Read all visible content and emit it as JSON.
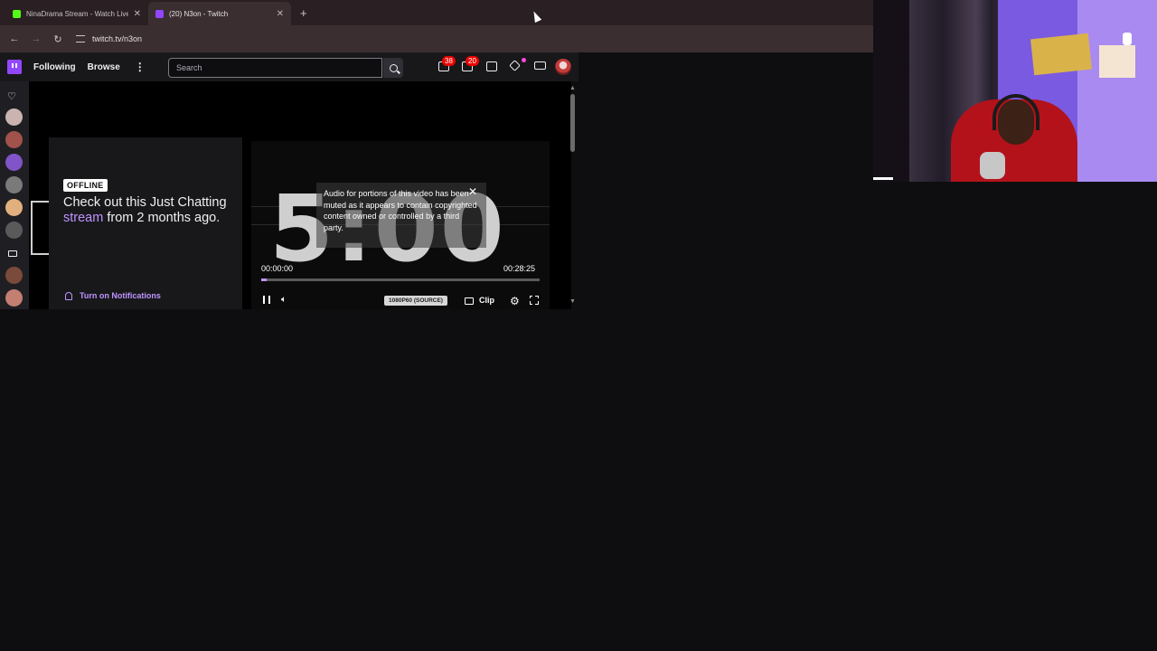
{
  "browser": {
    "tabs": [
      {
        "title": "NinaDrama Stream - Watch Live",
        "favicon_color": "#53fc18"
      },
      {
        "title": "(20) N3on - Twitch",
        "favicon_color": "#9147ff"
      }
    ],
    "url": "twitch.tv/n3on"
  },
  "twitch_nav": {
    "following": "Following",
    "browse": "Browse",
    "search_placeholder": "Search",
    "badge_1": "38",
    "badge_2": "20"
  },
  "offline": {
    "badge": "OFFLINE",
    "text_prefix": "Check out this Just Chatting ",
    "text_link": "stream",
    "text_suffix": " from 2 months ago.",
    "notifications": "Turn on Notifications"
  },
  "player": {
    "big_time": "5:00",
    "muted_notice": "Audio for portions of this video has been muted as it appears to contain copyrighted content owned or controlled by a third party.",
    "current_time": "00:00:00",
    "duration": "00:28:25",
    "progress_fraction": 0.02,
    "quality": "1080P60 (SOURCE)",
    "clip": "Clip"
  },
  "colors": {
    "twitch_purple": "#9147ff",
    "link_purple": "#bf94ff",
    "badge_red": "#eb0400"
  }
}
